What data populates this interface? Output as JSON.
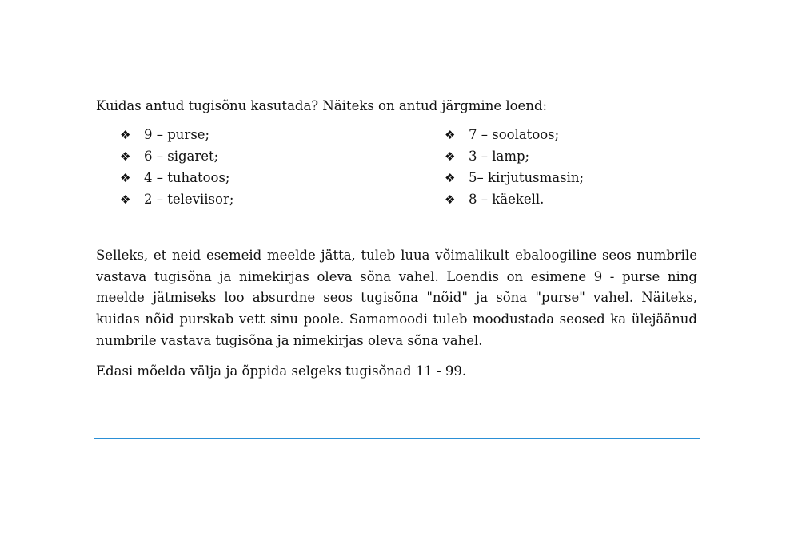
{
  "intro": "Kuidas antud tugisõnu kasutada? Näiteks on antud järgmine loend:",
  "bullet_symbol": "❖",
  "list_left": [
    "9 – purse;",
    "6 – sigaret;",
    "4 – tuhatoos;",
    "2 – televiisor;"
  ],
  "list_right": [
    "7 – soolatoos;",
    "3 – lamp;",
    "5– kirjutusmasin;",
    "8 – käekell."
  ],
  "paragraph1": "Selleks, et neid esemeid meelde jätta, tuleb luua võimalikult ebaloogiline seos numbrile vastava tugisõna ja nimekirjas oleva sõna vahel. Loendis on esimene 9 - purse ning meelde jätmiseks loo absurdne seos tugisõna \"nõid\" ja sõna \"purse\" vahel. Näiteks, kuidas nõid purskab vett sinu poole. Samamoodi tuleb moodustada seosed ka ülejäänud numbrile vastava tugisõna ja nimekirjas oleva sõna vahel.",
  "paragraph2": "Edasi mõelda välja ja õppida selgeks tugisõnad 11 - 99.",
  "colors": {
    "rule": "#2a8fd6",
    "text": "#111111"
  }
}
